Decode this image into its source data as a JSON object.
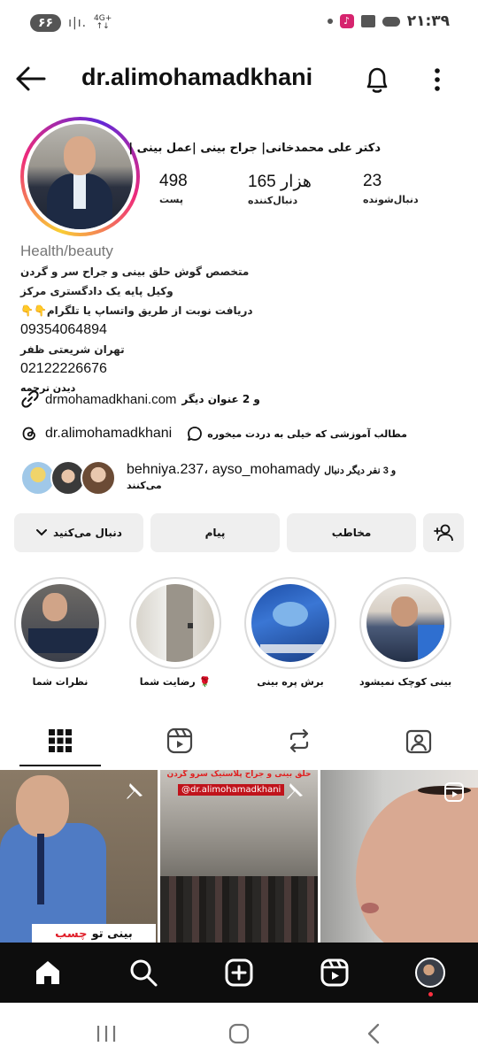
{
  "status_bar": {
    "battery": "۶۶",
    "network": "4G+",
    "time": "۲۱:۳۹"
  },
  "header": {
    "username": "dr.alimohamadkhani"
  },
  "profile": {
    "full_name": "دکتر علی محمدخانی| جراح بینی |عمل بینی |",
    "stats": [
      {
        "value": "498",
        "label": "پست"
      },
      {
        "value": "165 هزار",
        "label": "دنبال‌کننده"
      },
      {
        "value": "23",
        "label": "دنبال‌شونده"
      }
    ],
    "category": "Health/beauty",
    "bio_lines": [
      "متخصص گوش  حلق بینی و جراح  سر و گردن",
      "وکیل پایه یک دادگستری مرکز",
      "دریافت نوبت از طریق واتساپ یا تلگرام👇👇"
    ],
    "phone1": "09354064894",
    "address": "تهران شریعتی ظفر",
    "phone2": "02122226676",
    "see_translation": "دیدن ترجمه",
    "link": "drmohamadkhani.com",
    "link_extra": "و 2 عنوان دیگر",
    "threads_handle": "dr.alimohamadkhani",
    "threads_tag": "مطالب آموزشی که خیلی به دردت میخوره",
    "followed_by_names": "behniya.237، ayso_mohamady",
    "followed_by_suffix": "و 3 نفر دیگر دنبال",
    "followed_by_line2": "می‌کنند"
  },
  "actions": {
    "follow": "دنبال می‌کنید",
    "message": "پیام",
    "contact": "مخاطب"
  },
  "highlights": [
    {
      "label": "بینی کوچک نمیشود"
    },
    {
      "label": "برش پره بینی"
    },
    {
      "label": "رضایت شما 🌹"
    },
    {
      "label": "نظرات شما"
    }
  ],
  "posts": [
    {
      "overlay_1": "چسب",
      "overlay_2": "بینی تو"
    },
    {
      "overlay_top": "حلق بینی و جراح پلاستیک سرو گردن",
      "overlay_handle": "@dr.alimohamadkhani"
    },
    {
      "overlay": ""
    }
  ],
  "colors": {
    "accent_pink": "#ee2a7b",
    "accent_yellow": "#f9ce34",
    "accent_purple": "#6228d7",
    "button_bg": "#efefef",
    "nav_bg": "#0d0d0d",
    "notification_dot": "#ff3040"
  }
}
